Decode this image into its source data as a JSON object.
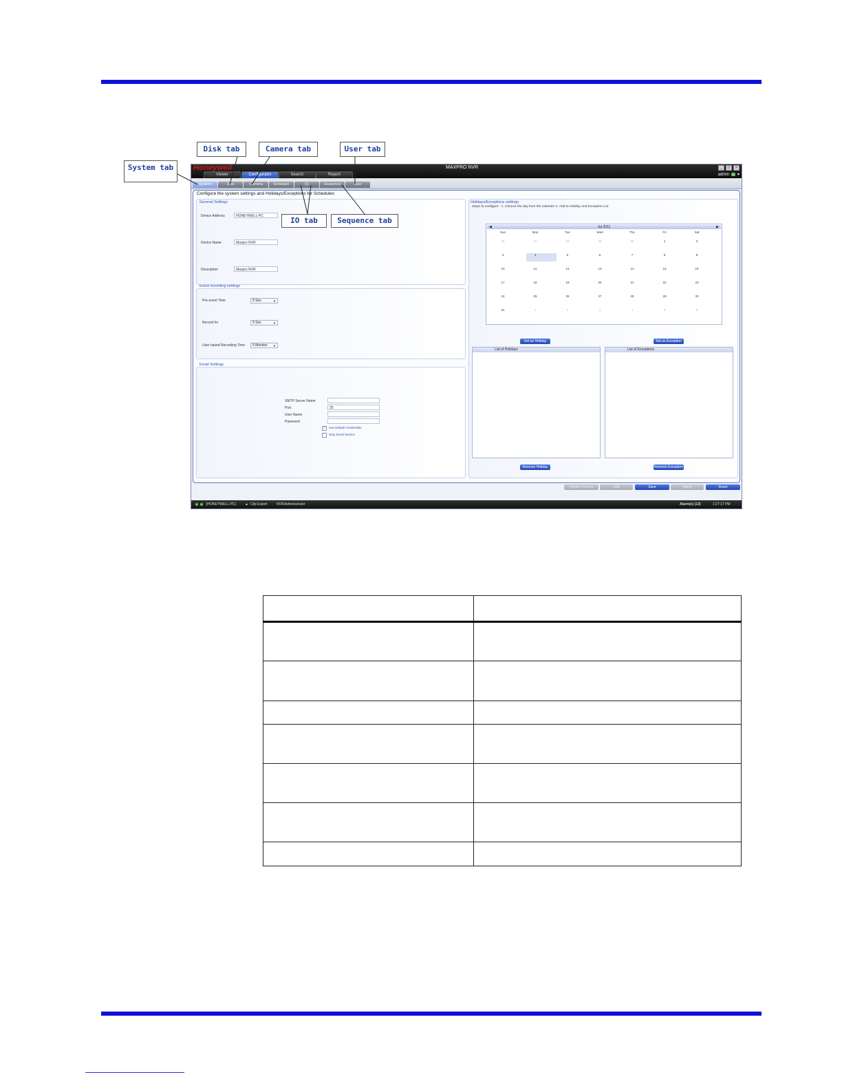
{
  "window": {
    "brand": "Honeywell",
    "title": "MAXPRO NVR",
    "user": "admin",
    "main_tabs": [
      "Viewer",
      "Configurator",
      "Search",
      "Report"
    ]
  },
  "sub_tabs": [
    "System",
    "Disk",
    "Camera",
    "Schedule",
    "IO",
    "Sequence",
    "User"
  ],
  "instruction": "Configure the system settings and Holidays/Exceptions for Schedules",
  "general": {
    "title": "General Settings",
    "device_address_label": "Device Address",
    "device_address_value": "HONEYWELL-PC",
    "device_name_label": "Device Name",
    "device_name_value": "Maxpro NVR",
    "description_label": "Description",
    "description_value": "Maxpro NVR"
  },
  "event_recording": {
    "title": "Event recording settings",
    "pre_event_label": "Pre-event Time",
    "pre_event_value": "5 Sec.",
    "record_for_label": "Record for",
    "record_for_value": "5 Sec.",
    "user_based_label": "User based Recording Time",
    "user_based_value": "5 Minutes"
  },
  "email": {
    "title": "Email Settings",
    "smtp_label": "SMTP Server Name",
    "smtp_value": "",
    "port_label": "Port",
    "port_value": "25",
    "username_label": "User Name",
    "username_value": "",
    "password_label": "Password",
    "password_value": "",
    "use_default_credentials": "Use Default Credentials",
    "stop_email_service": "Stop Email Service"
  },
  "holidays": {
    "title": "Holidays/Exceptions settings",
    "steps": "Steps to configure : 1. Choose the day from the calender 2. Add to Holiday and Exception List",
    "month": "Jul 2011",
    "weekdays": [
      "Sun",
      "Mon",
      "Tue",
      "Wed",
      "Thu",
      "Fri",
      "Sat"
    ],
    "weeks": [
      [
        "26",
        "27",
        "28",
        "29",
        "30",
        "1",
        "2"
      ],
      [
        "3",
        "4",
        "5",
        "6",
        "7",
        "8",
        "9"
      ],
      [
        "10",
        "11",
        "12",
        "13",
        "14",
        "15",
        "16"
      ],
      [
        "17",
        "18",
        "19",
        "20",
        "21",
        "22",
        "23"
      ],
      [
        "24",
        "25",
        "26",
        "27",
        "28",
        "29",
        "30"
      ],
      [
        "31",
        "1",
        "2",
        "3",
        "4",
        "5",
        "6"
      ]
    ],
    "selected_day": "4",
    "set_holiday": "Set as Holiday",
    "set_exception": "Set as Exception",
    "list_holidays": "List of Holidays",
    "list_exceptions": "List of Exceptions",
    "remove_holiday": "Remove Holiday",
    "remove_exception": "Remove Exception"
  },
  "action_buttons": [
    "Update Devices",
    "Add",
    "Save",
    "Apply",
    "Reset"
  ],
  "status_bar": {
    "device": "[HONEYWELL-PC]",
    "clip_export": "Clip Export",
    "user": "NVR\\Administrator",
    "alarms": "Alarm(s) (13)",
    "time": "1:27:17 PM"
  },
  "callouts": {
    "system": "System tab",
    "disk": "Disk tab",
    "camera": "Camera tab",
    "user": "User tab",
    "io": "IO tab",
    "sequence": "Sequence tab"
  }
}
